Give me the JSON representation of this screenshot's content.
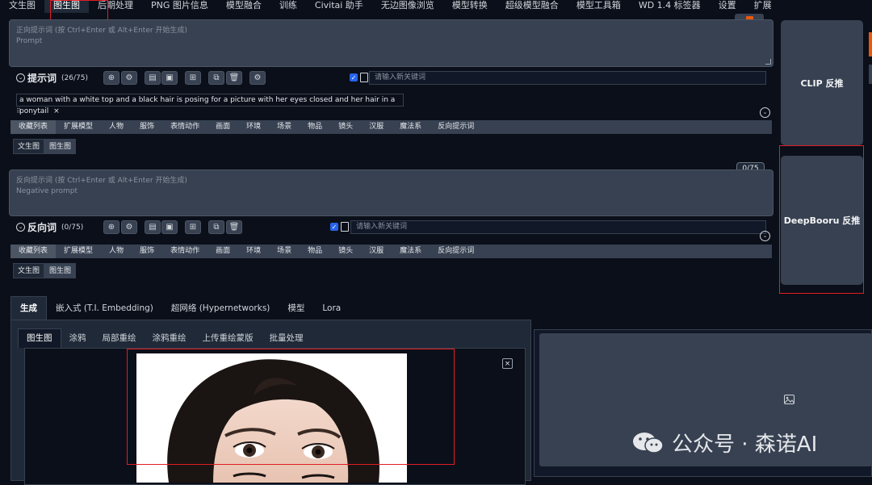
{
  "top_tabs": [
    "文生图",
    "图生图",
    "后期处理",
    "PNG 图片信息",
    "模型融合",
    "训练",
    "Civitai 助手",
    "无边图像浏览",
    "模型转换",
    "超级模型融合",
    "模型工具箱",
    "WD 1.4 标签器",
    "设置",
    "扩展"
  ],
  "prompt": {
    "placeholder_line1": "正向提示词 (按 Ctrl+Enter 或 Alt+Enter 开始生成)",
    "placeholder_line2": "Prompt",
    "label": "提示词",
    "count": "(26/75)",
    "keyword_placeholder": "请输入新关键词",
    "tag_text": "a woman with a white top and a black hair is posing for a picture with her eyes closed and her hair in a ponytail",
    "tag_close": "×"
  },
  "categories": [
    "收藏列表",
    "扩展模型",
    "人物",
    "服饰",
    "表情动作",
    "画面",
    "环境",
    "场景",
    "物品",
    "镜头",
    "汉服",
    "魔法系",
    "反向提示词"
  ],
  "sub_tabs": [
    "文生图",
    "图生图"
  ],
  "negative": {
    "counter": "0/75",
    "placeholder_line1": "反向提示词 (按 Ctrl+Enter 或 Alt+Enter 开始生成)",
    "placeholder_line2": "Negative prompt",
    "label": "反向词",
    "count": "(0/75)",
    "keyword_placeholder": "请输入新关键词"
  },
  "right_buttons": {
    "clip": "CLIP 反推",
    "deepbooru": "DeepBooru 反推"
  },
  "main_tabs": [
    "生成",
    "嵌入式 (T.I. Embedding)",
    "超网络 (Hypernetworks)",
    "模型",
    "Lora"
  ],
  "img_tabs": [
    "图生图",
    "涂鸦",
    "局部重绘",
    "涂鸦重绘",
    "上传重绘蒙版",
    "批量处理"
  ],
  "close_symbol": "×",
  "watermark": {
    "text": "公众号 · 森诺AI"
  },
  "colors": {
    "background": "#0b0f19",
    "panel": "#1f2937",
    "input": "#374151",
    "highlight_box": "#e11d25",
    "checkbox": "#2563eb"
  }
}
